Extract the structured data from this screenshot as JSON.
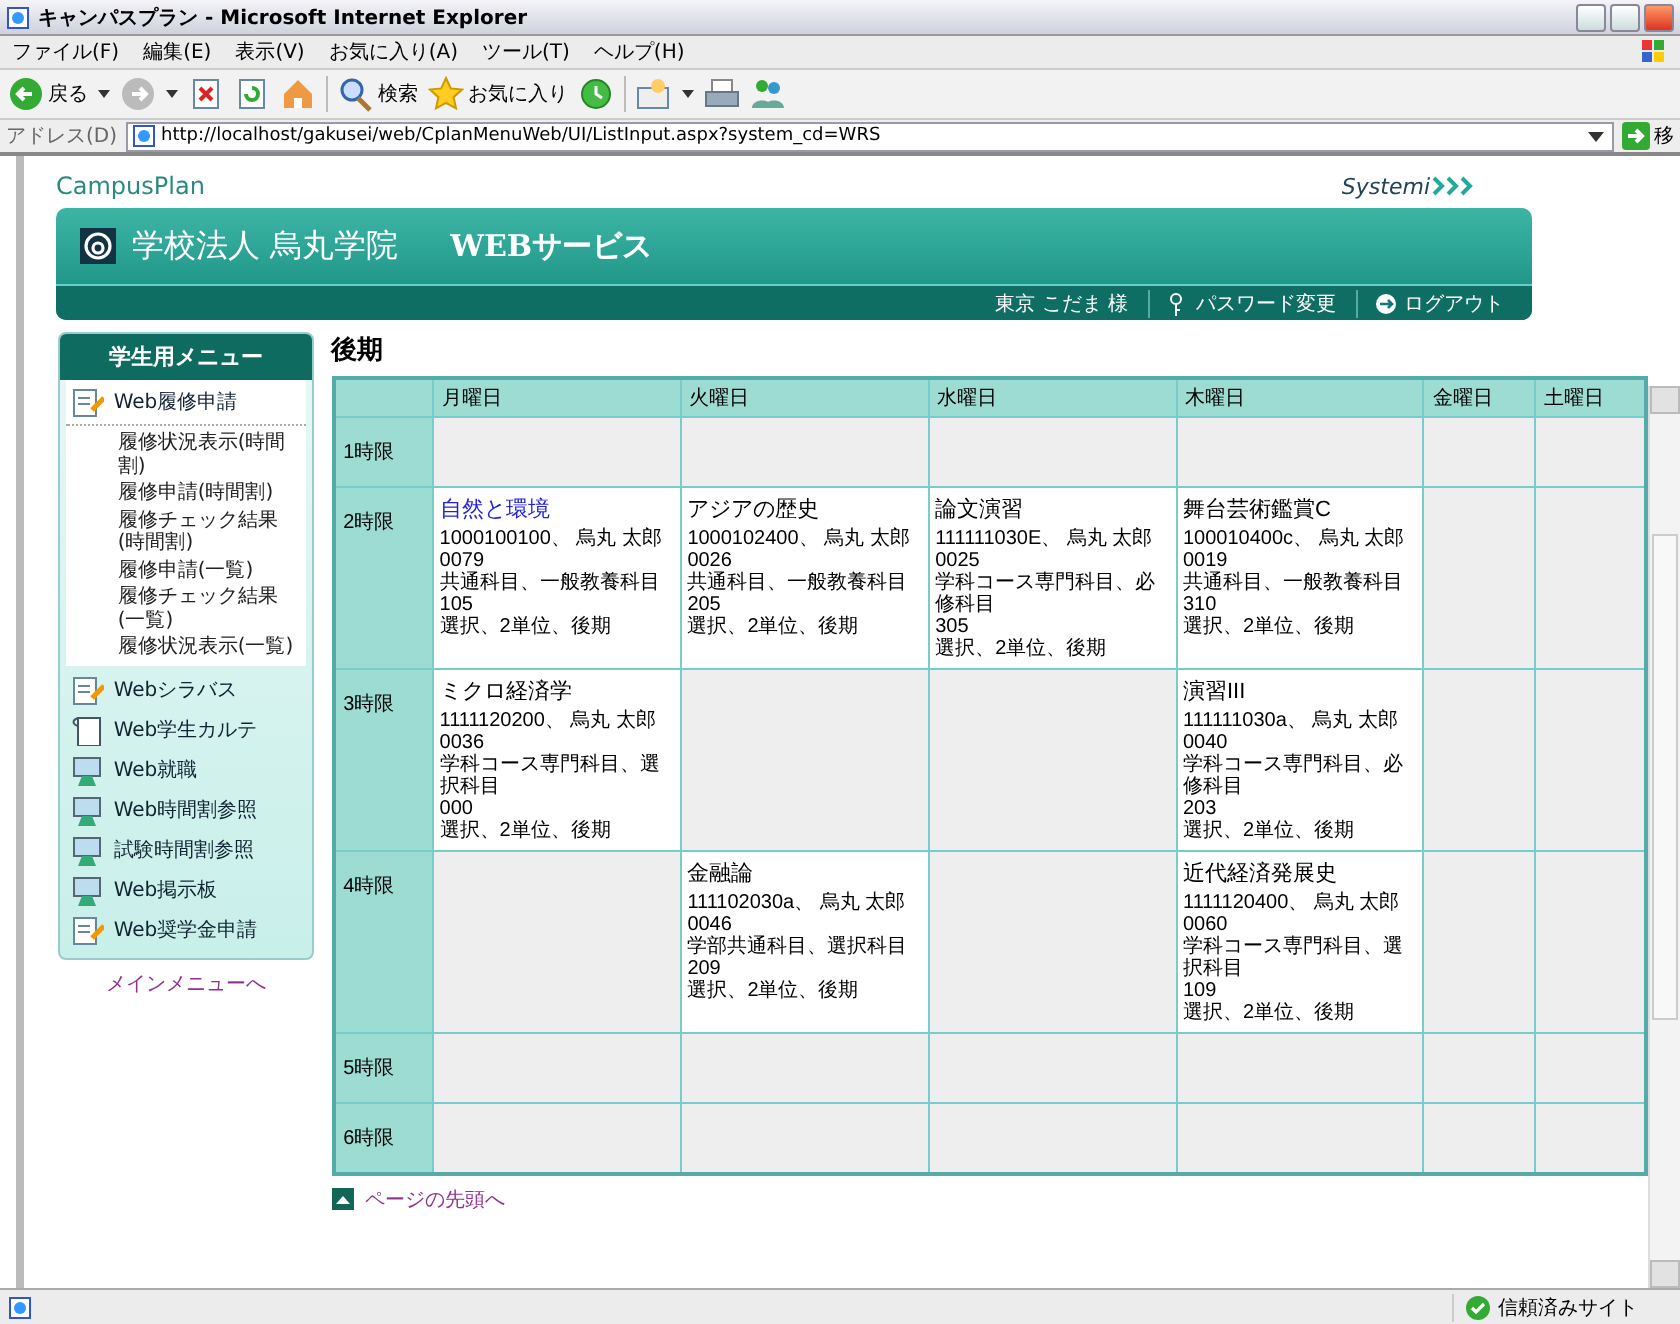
{
  "window": {
    "title": "キャンパスプラン - Microsoft Internet Explorer"
  },
  "menu_bar": [
    "ファイル(F)",
    "編集(E)",
    "表示(V)",
    "お気に入り(A)",
    "ツール(T)",
    "ヘルプ(H)"
  ],
  "toolbar": [
    {
      "kind": "back",
      "label": "戻る"
    },
    {
      "kind": "forward"
    },
    {
      "kind": "stop"
    },
    {
      "kind": "refresh"
    },
    {
      "kind": "home"
    },
    {
      "kind": "search",
      "label": "検索"
    },
    {
      "kind": "favorites",
      "label": "お気に入り"
    },
    {
      "kind": "history"
    },
    {
      "kind": "mail"
    },
    {
      "kind": "print"
    },
    {
      "kind": "messenger"
    }
  ],
  "address_bar": {
    "label": "アドレス(D)",
    "url": "http://localhost/gakusei/web/CplanMenuWeb/UI/ListInput.aspx?system_cd=WRS",
    "go_label": "移"
  },
  "site": {
    "brand": "CampusPlan",
    "vendor": "Systemi",
    "school": "学校法人 烏丸学院",
    "service": "WEBサービス",
    "user": "東京 こだま 様",
    "links": [
      {
        "kind": "password",
        "label": "パスワード変更"
      },
      {
        "kind": "logout",
        "label": "ログアウト"
      }
    ]
  },
  "sidebar": {
    "title": "学生用メニュー",
    "items": [
      {
        "kind": "form",
        "label": "Web履修申請",
        "expanded": true,
        "children": [
          {
            "label": "履修状況表示(時間割)"
          },
          {
            "label": "履修申請(時間割)"
          },
          {
            "label": "履修チェック結果(時間割)"
          },
          {
            "label": "履修申請(一覧)"
          },
          {
            "label": "履修チェック結果(一覧)"
          },
          {
            "label": "履修状況表示(一覧)"
          }
        ]
      },
      {
        "kind": "form",
        "label": "Webシラバス",
        "expanded": false
      },
      {
        "kind": "card",
        "label": "Web学生カルテ",
        "expanded": false
      },
      {
        "kind": "screen",
        "label": "Web就職",
        "expanded": false
      },
      {
        "kind": "screen",
        "label": "Web時間割参照",
        "expanded": false
      },
      {
        "kind": "screen",
        "label": "試験時間割参照",
        "expanded": false
      },
      {
        "kind": "screen",
        "label": "Web掲示板",
        "expanded": false
      },
      {
        "kind": "form",
        "label": "Web奨学金申請",
        "expanded": false
      }
    ],
    "main_menu_link": "メインメニューへ"
  },
  "timetable": {
    "title": "後期",
    "days": [
      "月曜日",
      "火曜日",
      "水曜日",
      "木曜日",
      "金曜日",
      "土曜日"
    ],
    "rows": [
      {
        "period": "1時限",
        "cells": [
          {
            "kind": "empty"
          },
          {
            "kind": "empty"
          },
          {
            "kind": "empty"
          },
          {
            "kind": "empty"
          },
          {
            "kind": "empty"
          },
          {
            "kind": "empty"
          }
        ]
      },
      {
        "period": "2時限",
        "cells": [
          {
            "kind": "course",
            "title": "自然と環境",
            "link": true,
            "lines": [
              "1000100100、 烏丸 太郎",
              "0079",
              "共通科目、一般教養科目",
              "105",
              "選択、2単位、後期"
            ]
          },
          {
            "kind": "course",
            "title": "アジアの歴史",
            "link": false,
            "lines": [
              "1000102400、 烏丸 太郎",
              "0026",
              "共通科目、一般教養科目",
              "205",
              "選択、2単位、後期"
            ]
          },
          {
            "kind": "course",
            "title": "論文演習",
            "link": false,
            "lines": [
              "111111030E、 烏丸 太郎",
              "0025",
              "学科コース専門科目、必修科目",
              "305",
              "選択、2単位、後期"
            ]
          },
          {
            "kind": "course",
            "title": "舞台芸術鑑賞C",
            "link": false,
            "lines": [
              "100010400c、 烏丸 太郎",
              "0019",
              "共通科目、一般教養科目",
              "310",
              "選択、2単位、後期"
            ]
          },
          {
            "kind": "empty"
          },
          {
            "kind": "empty"
          }
        ]
      },
      {
        "period": "3時限",
        "cells": [
          {
            "kind": "course",
            "title": "ミクロ経済学",
            "link": false,
            "lines": [
              "1111120200、 烏丸 太郎",
              "0036",
              "学科コース専門科目、選択科目",
              "000",
              "選択、2単位、後期"
            ]
          },
          {
            "kind": "empty"
          },
          {
            "kind": "empty"
          },
          {
            "kind": "course",
            "title": "演習III",
            "link": false,
            "lines": [
              "111111030a、 烏丸 太郎",
              "0040",
              "学科コース専門科目、必修科目",
              "203",
              "選択、2単位、後期"
            ]
          },
          {
            "kind": "empty"
          },
          {
            "kind": "empty"
          }
        ]
      },
      {
        "period": "4時限",
        "cells": [
          {
            "kind": "empty"
          },
          {
            "kind": "course",
            "title": "金融論",
            "link": false,
            "lines": [
              "111102030a、 烏丸 太郎",
              "0046",
              "学部共通科目、選択科目",
              "209",
              "選択、2単位、後期"
            ]
          },
          {
            "kind": "empty"
          },
          {
            "kind": "course",
            "title": "近代経済発展史",
            "link": false,
            "lines": [
              "1111120400、 烏丸 太郎",
              "0060",
              "学科コース専門科目、選択科目",
              "109",
              "選択、2単位、後期"
            ]
          },
          {
            "kind": "empty"
          },
          {
            "kind": "empty"
          }
        ]
      },
      {
        "period": "5時限",
        "cells": [
          {
            "kind": "empty"
          },
          {
            "kind": "empty"
          },
          {
            "kind": "empty"
          },
          {
            "kind": "empty"
          },
          {
            "kind": "empty"
          },
          {
            "kind": "empty"
          }
        ]
      },
      {
        "period": "6時限",
        "cells": [
          {
            "kind": "empty"
          },
          {
            "kind": "empty"
          },
          {
            "kind": "empty"
          },
          {
            "kind": "empty"
          },
          {
            "kind": "empty"
          },
          {
            "kind": "empty"
          }
        ]
      }
    ]
  },
  "page_top_link": "ページの先頭へ",
  "status_bar": {
    "zone": "信頼済みサイト"
  }
}
